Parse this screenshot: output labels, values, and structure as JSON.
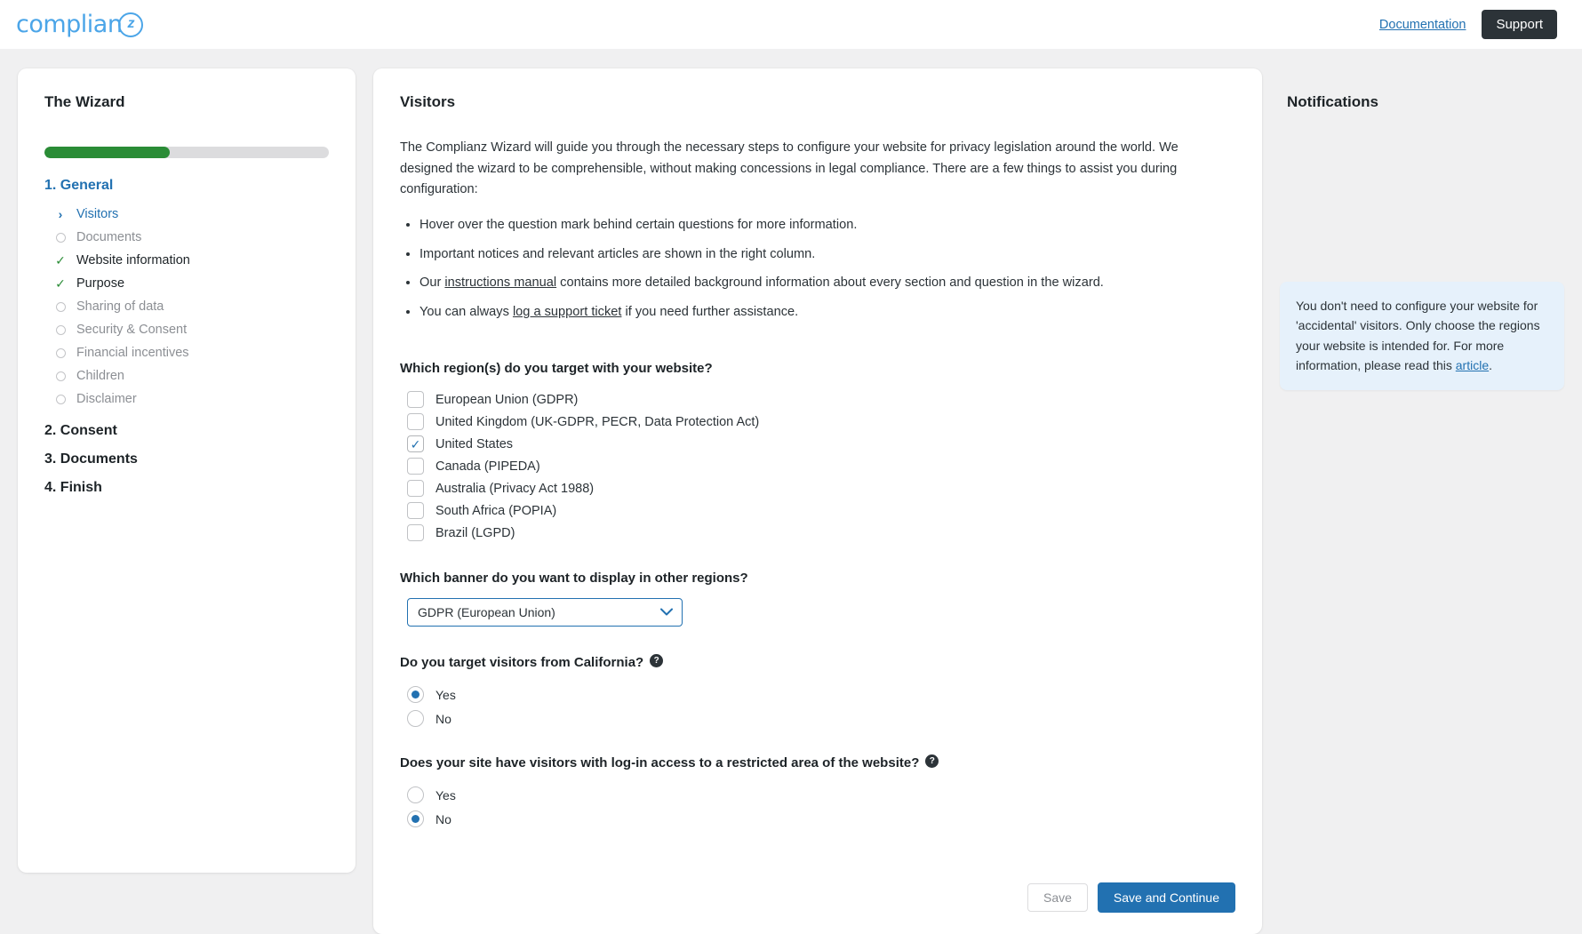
{
  "header": {
    "logo_text": "complian",
    "logo_mark": "z",
    "documentation_link": "Documentation",
    "support_button": "Support"
  },
  "sidebar": {
    "title": "The Wizard",
    "progress_percent": 44,
    "steps": [
      {
        "label": "1. General",
        "active": true,
        "items": [
          {
            "label": "Visitors",
            "state": "current",
            "icon": "chevron-right-icon"
          },
          {
            "label": "Documents",
            "state": "todo",
            "icon": "circle-icon"
          },
          {
            "label": "Website information",
            "state": "done",
            "icon": "check-icon"
          },
          {
            "label": "Purpose",
            "state": "done",
            "icon": "check-icon"
          },
          {
            "label": "Sharing of data",
            "state": "todo",
            "icon": "circle-icon"
          },
          {
            "label": "Security & Consent",
            "state": "todo",
            "icon": "circle-icon"
          },
          {
            "label": "Financial incentives",
            "state": "todo",
            "icon": "circle-icon"
          },
          {
            "label": "Children",
            "state": "todo",
            "icon": "circle-icon"
          },
          {
            "label": "Disclaimer",
            "state": "todo",
            "icon": "circle-icon"
          }
        ]
      },
      {
        "label": "2. Consent",
        "active": false,
        "items": []
      },
      {
        "label": "3. Documents",
        "active": false,
        "items": []
      },
      {
        "label": "4. Finish",
        "active": false,
        "items": []
      }
    ]
  },
  "main": {
    "title": "Visitors",
    "intro_paragraph": "The Complianz Wizard will guide you through the necessary steps to configure your website for privacy legislation around the world. We designed the wizard to be comprehensible, without making concessions in legal compliance. There are a few things to assist you during configuration:",
    "bullets": [
      {
        "pre": "Hover over the question mark behind certain questions for more information.",
        "link": "",
        "post": ""
      },
      {
        "pre": "Important notices and relevant articles are shown in the right column.",
        "link": "",
        "post": ""
      },
      {
        "pre": "Our ",
        "link": "instructions manual",
        "post": " contains more detailed background information about every section and question in the wizard."
      },
      {
        "pre": "You can always ",
        "link": "log a support ticket",
        "post": " if you need further assistance."
      }
    ],
    "regions_question": "Which region(s) do you target with your website?",
    "regions": [
      {
        "label": "European Union (GDPR)",
        "checked": false
      },
      {
        "label": "United Kingdom (UK-GDPR, PECR, Data Protection Act)",
        "checked": false
      },
      {
        "label": "United States",
        "checked": true
      },
      {
        "label": "Canada (PIPEDA)",
        "checked": false
      },
      {
        "label": "Australia (Privacy Act 1988)",
        "checked": false
      },
      {
        "label": "South Africa (POPIA)",
        "checked": false
      },
      {
        "label": "Brazil (LGPD)",
        "checked": false
      }
    ],
    "banner_question": "Which banner do you want to display in other regions?",
    "banner_selected": "GDPR (European Union)",
    "banner_options": [
      "GDPR (European Union)"
    ],
    "california_question": "Do you target visitors from California?",
    "california_help": "?",
    "california_options": [
      {
        "label": "Yes",
        "selected": true
      },
      {
        "label": "No",
        "selected": false
      }
    ],
    "login_question": "Does your site have visitors with log-in access to a restricted area of the website?",
    "login_help": "?",
    "login_options": [
      {
        "label": "Yes",
        "selected": false
      },
      {
        "label": "No",
        "selected": true
      }
    ],
    "save_label": "Save",
    "save_continue_label": "Save and Continue"
  },
  "notifications": {
    "title": "Notifications",
    "card": {
      "text_before_link": "You don't need to configure your website for 'accidental' visitors. Only choose the regions your website is intended for. For more information, please read this ",
      "link_text": "article",
      "text_after_link": "."
    }
  },
  "colors": {
    "brand_blue": "#4BA5E8",
    "accent_blue": "#2271b1",
    "progress_green": "#2a8c36",
    "dark": "#2c3338",
    "notif_bg": "#e6f1fb"
  }
}
